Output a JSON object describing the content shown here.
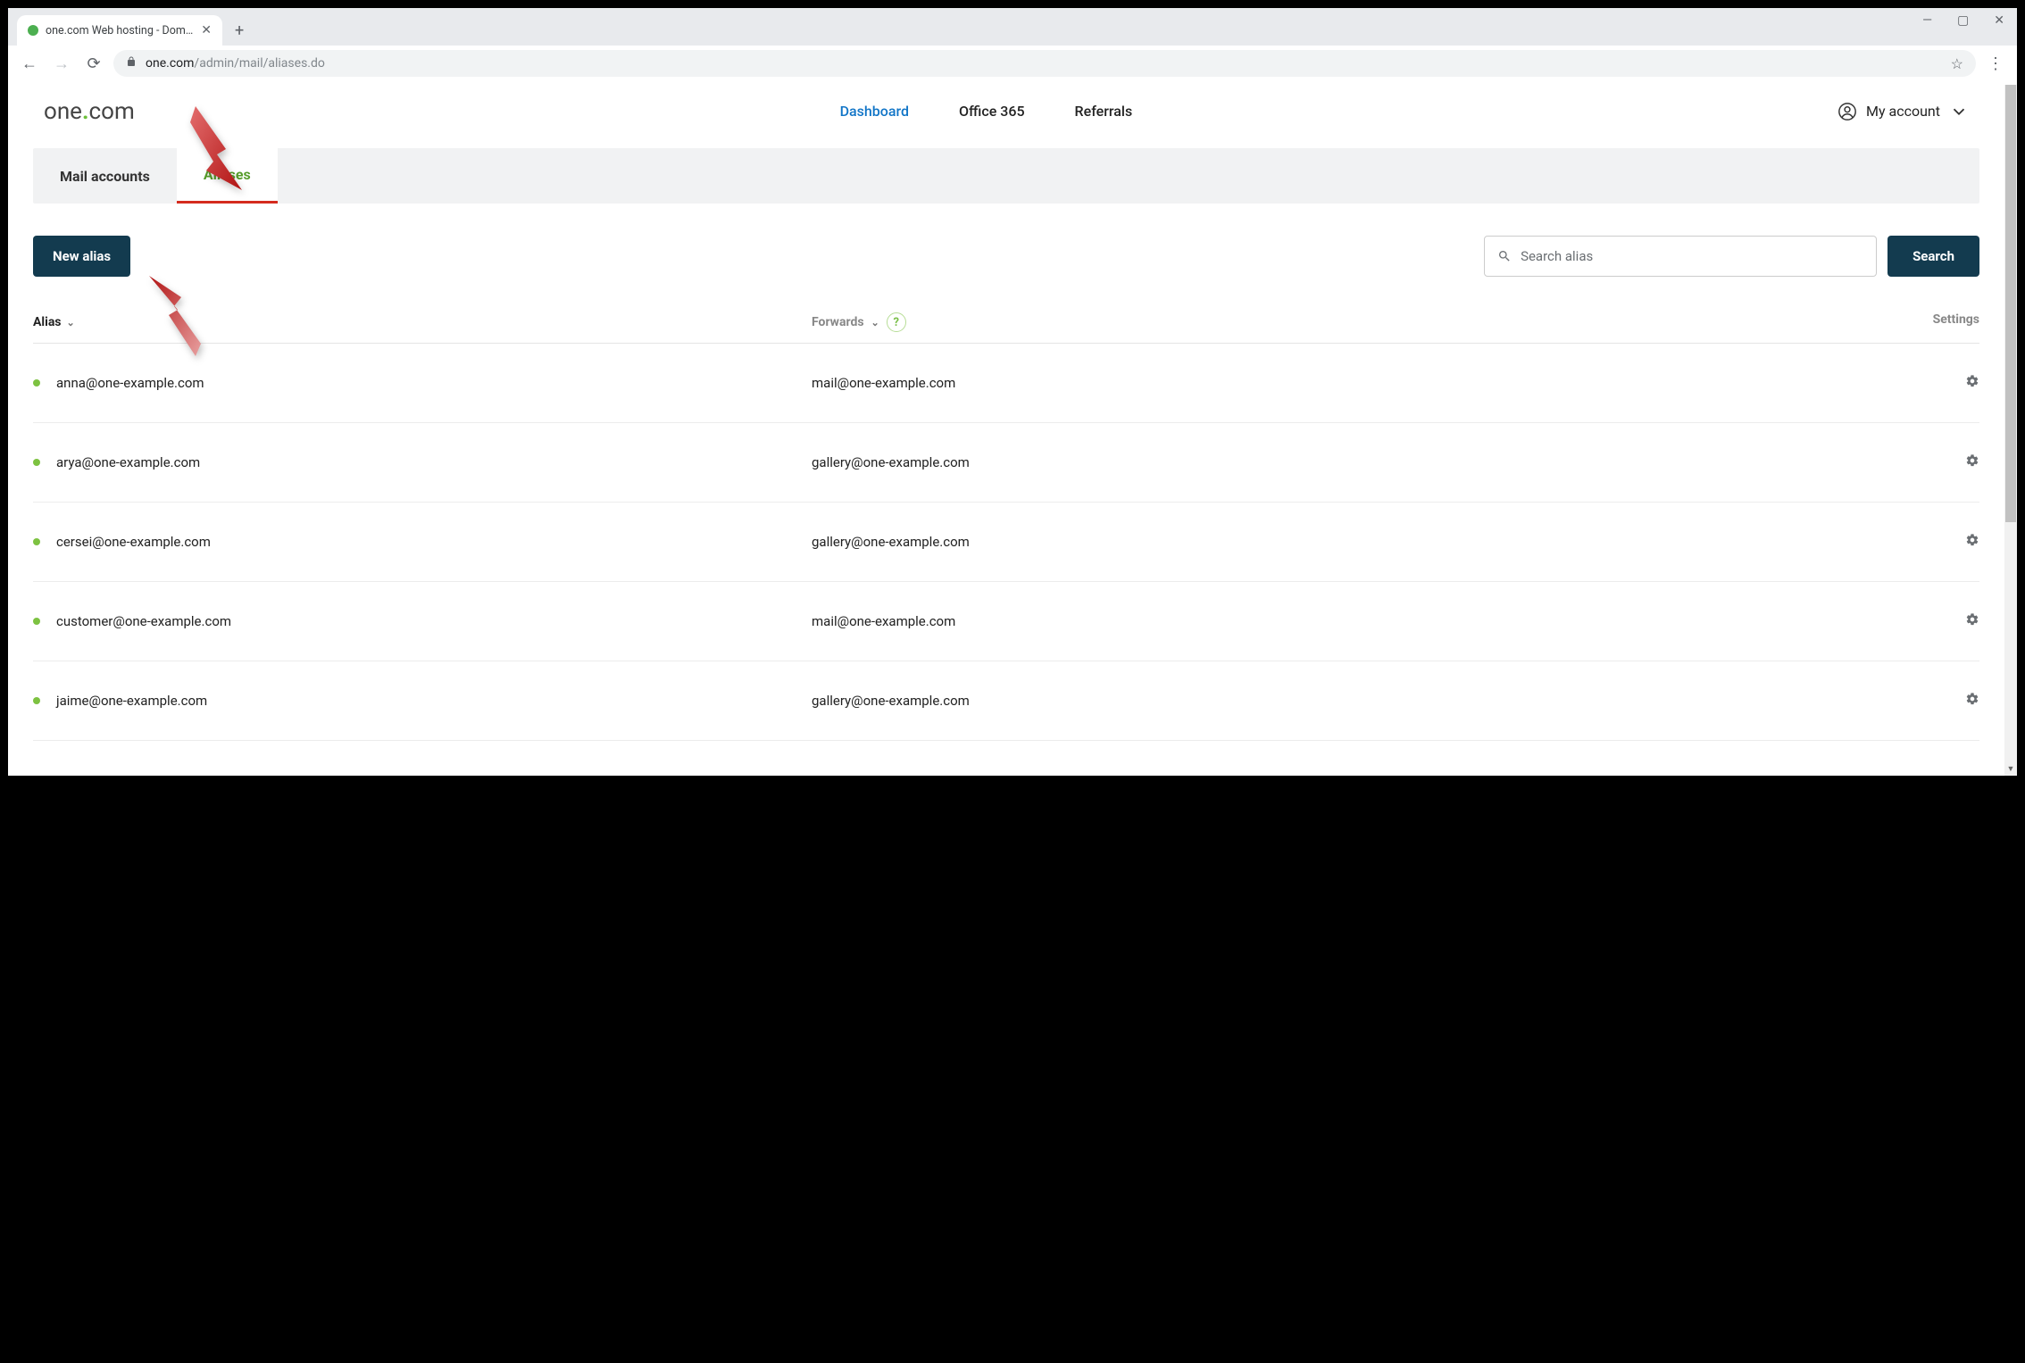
{
  "browser": {
    "tab_title": "one.com Web hosting  -  Domain",
    "url_host": "one.com",
    "url_path": "/admin/mail/aliases.do"
  },
  "header": {
    "logo_left": "one",
    "logo_dot": ".",
    "logo_right": "com",
    "nav": {
      "dashboard": "Dashboard",
      "office365": "Office 365",
      "referrals": "Referrals"
    },
    "account": "My account"
  },
  "tabs": {
    "mail_accounts": "Mail accounts",
    "aliases": "Aliases"
  },
  "actions": {
    "new_alias": "New alias",
    "search_placeholder": "Search alias",
    "search_button": "Search"
  },
  "columns": {
    "alias": "Alias",
    "forwards": "Forwards",
    "settings": "Settings"
  },
  "rows": [
    {
      "alias": "anna@one-example.com",
      "forwards": "mail@one-example.com"
    },
    {
      "alias": "arya@one-example.com",
      "forwards": "gallery@one-example.com"
    },
    {
      "alias": "cersei@one-example.com",
      "forwards": "gallery@one-example.com"
    },
    {
      "alias": "customer@one-example.com",
      "forwards": "mail@one-example.com"
    },
    {
      "alias": "jaime@one-example.com",
      "forwards": "gallery@one-example.com"
    }
  ]
}
